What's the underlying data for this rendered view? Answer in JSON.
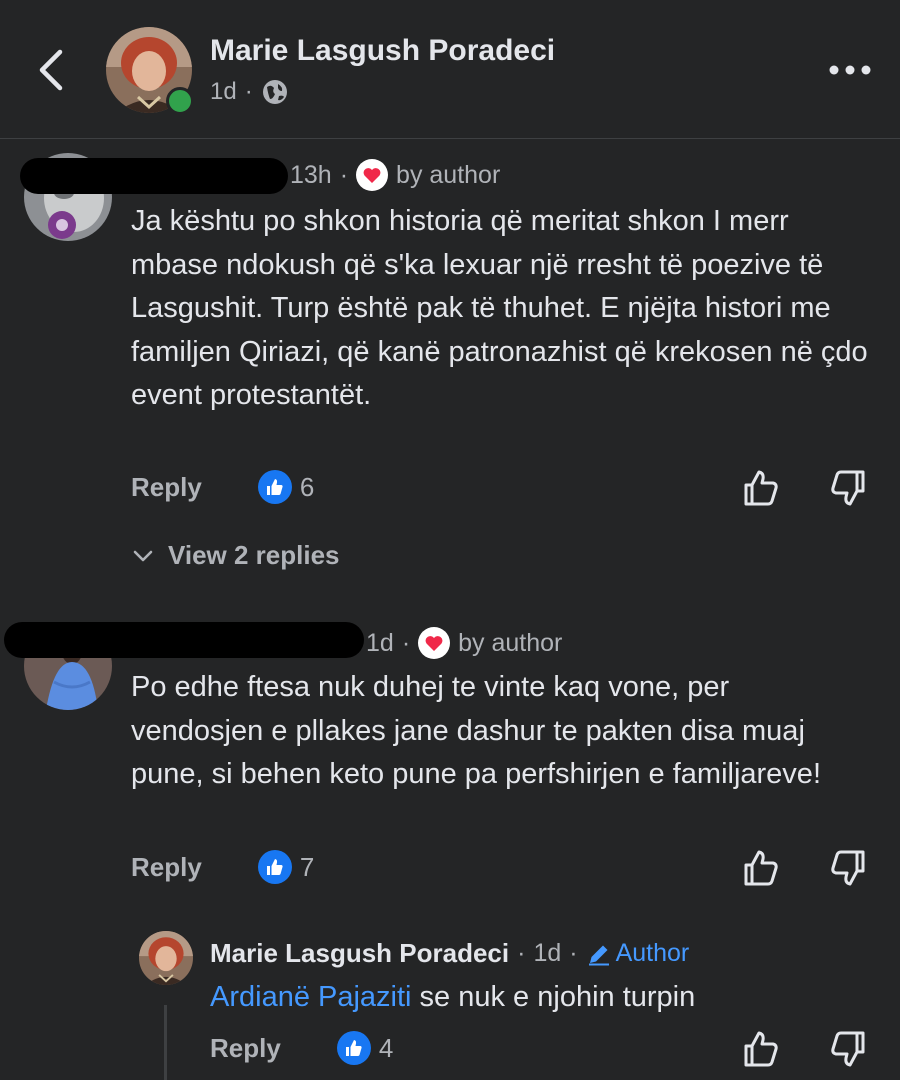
{
  "header": {
    "name": "Marie Lasgush Poradeci",
    "time": "1d",
    "separator": "·"
  },
  "comments": [
    {
      "time": "13h",
      "separator": "·",
      "by_author": "by author",
      "text": "Ja kështu po shkon historia që meritat shkon I merr mbase ndokush që s'ka lexuar një rresht të poezive të  Lasgushit. Turp është pak të thuhet. E njëjta histori me familjen Qiriazi, që kanë patronazhist që krekosen në çdo event protestantët.",
      "reply_label": "Reply",
      "like_count": "6",
      "view_replies": "View 2 replies"
    },
    {
      "time": "1d",
      "separator": "·",
      "by_author": "by author",
      "text": "Po edhe ftesa nuk duhej te vinte kaq vone, per vendosjen e pllakes jane dashur te pakten disa muaj pune, si behen keto pune pa perfshirjen e familjareve!",
      "reply_label": "Reply",
      "like_count": "7"
    }
  ],
  "reply": {
    "name": "Marie Lasgush Poradeci",
    "separator": "·",
    "time": "1d",
    "author_label": "Author",
    "mention": "Ardianë Pajaziti",
    "text": " se nuk e njohin turpin",
    "reply_label": "Reply",
    "like_count": "4"
  },
  "colors": {
    "background": "#242526",
    "text": "#e4e6eb",
    "secondary": "#b0b3b8",
    "accent": "#4599ff",
    "like": "#1877f2",
    "heart": "#f02849",
    "online": "#31a24c"
  },
  "icons": [
    "back-arrow-icon",
    "globe-icon",
    "more-dots-icon",
    "heart-icon",
    "thumbs-up-icon",
    "thumbs-down-icon",
    "chevron-down-icon",
    "pencil-icon"
  ]
}
